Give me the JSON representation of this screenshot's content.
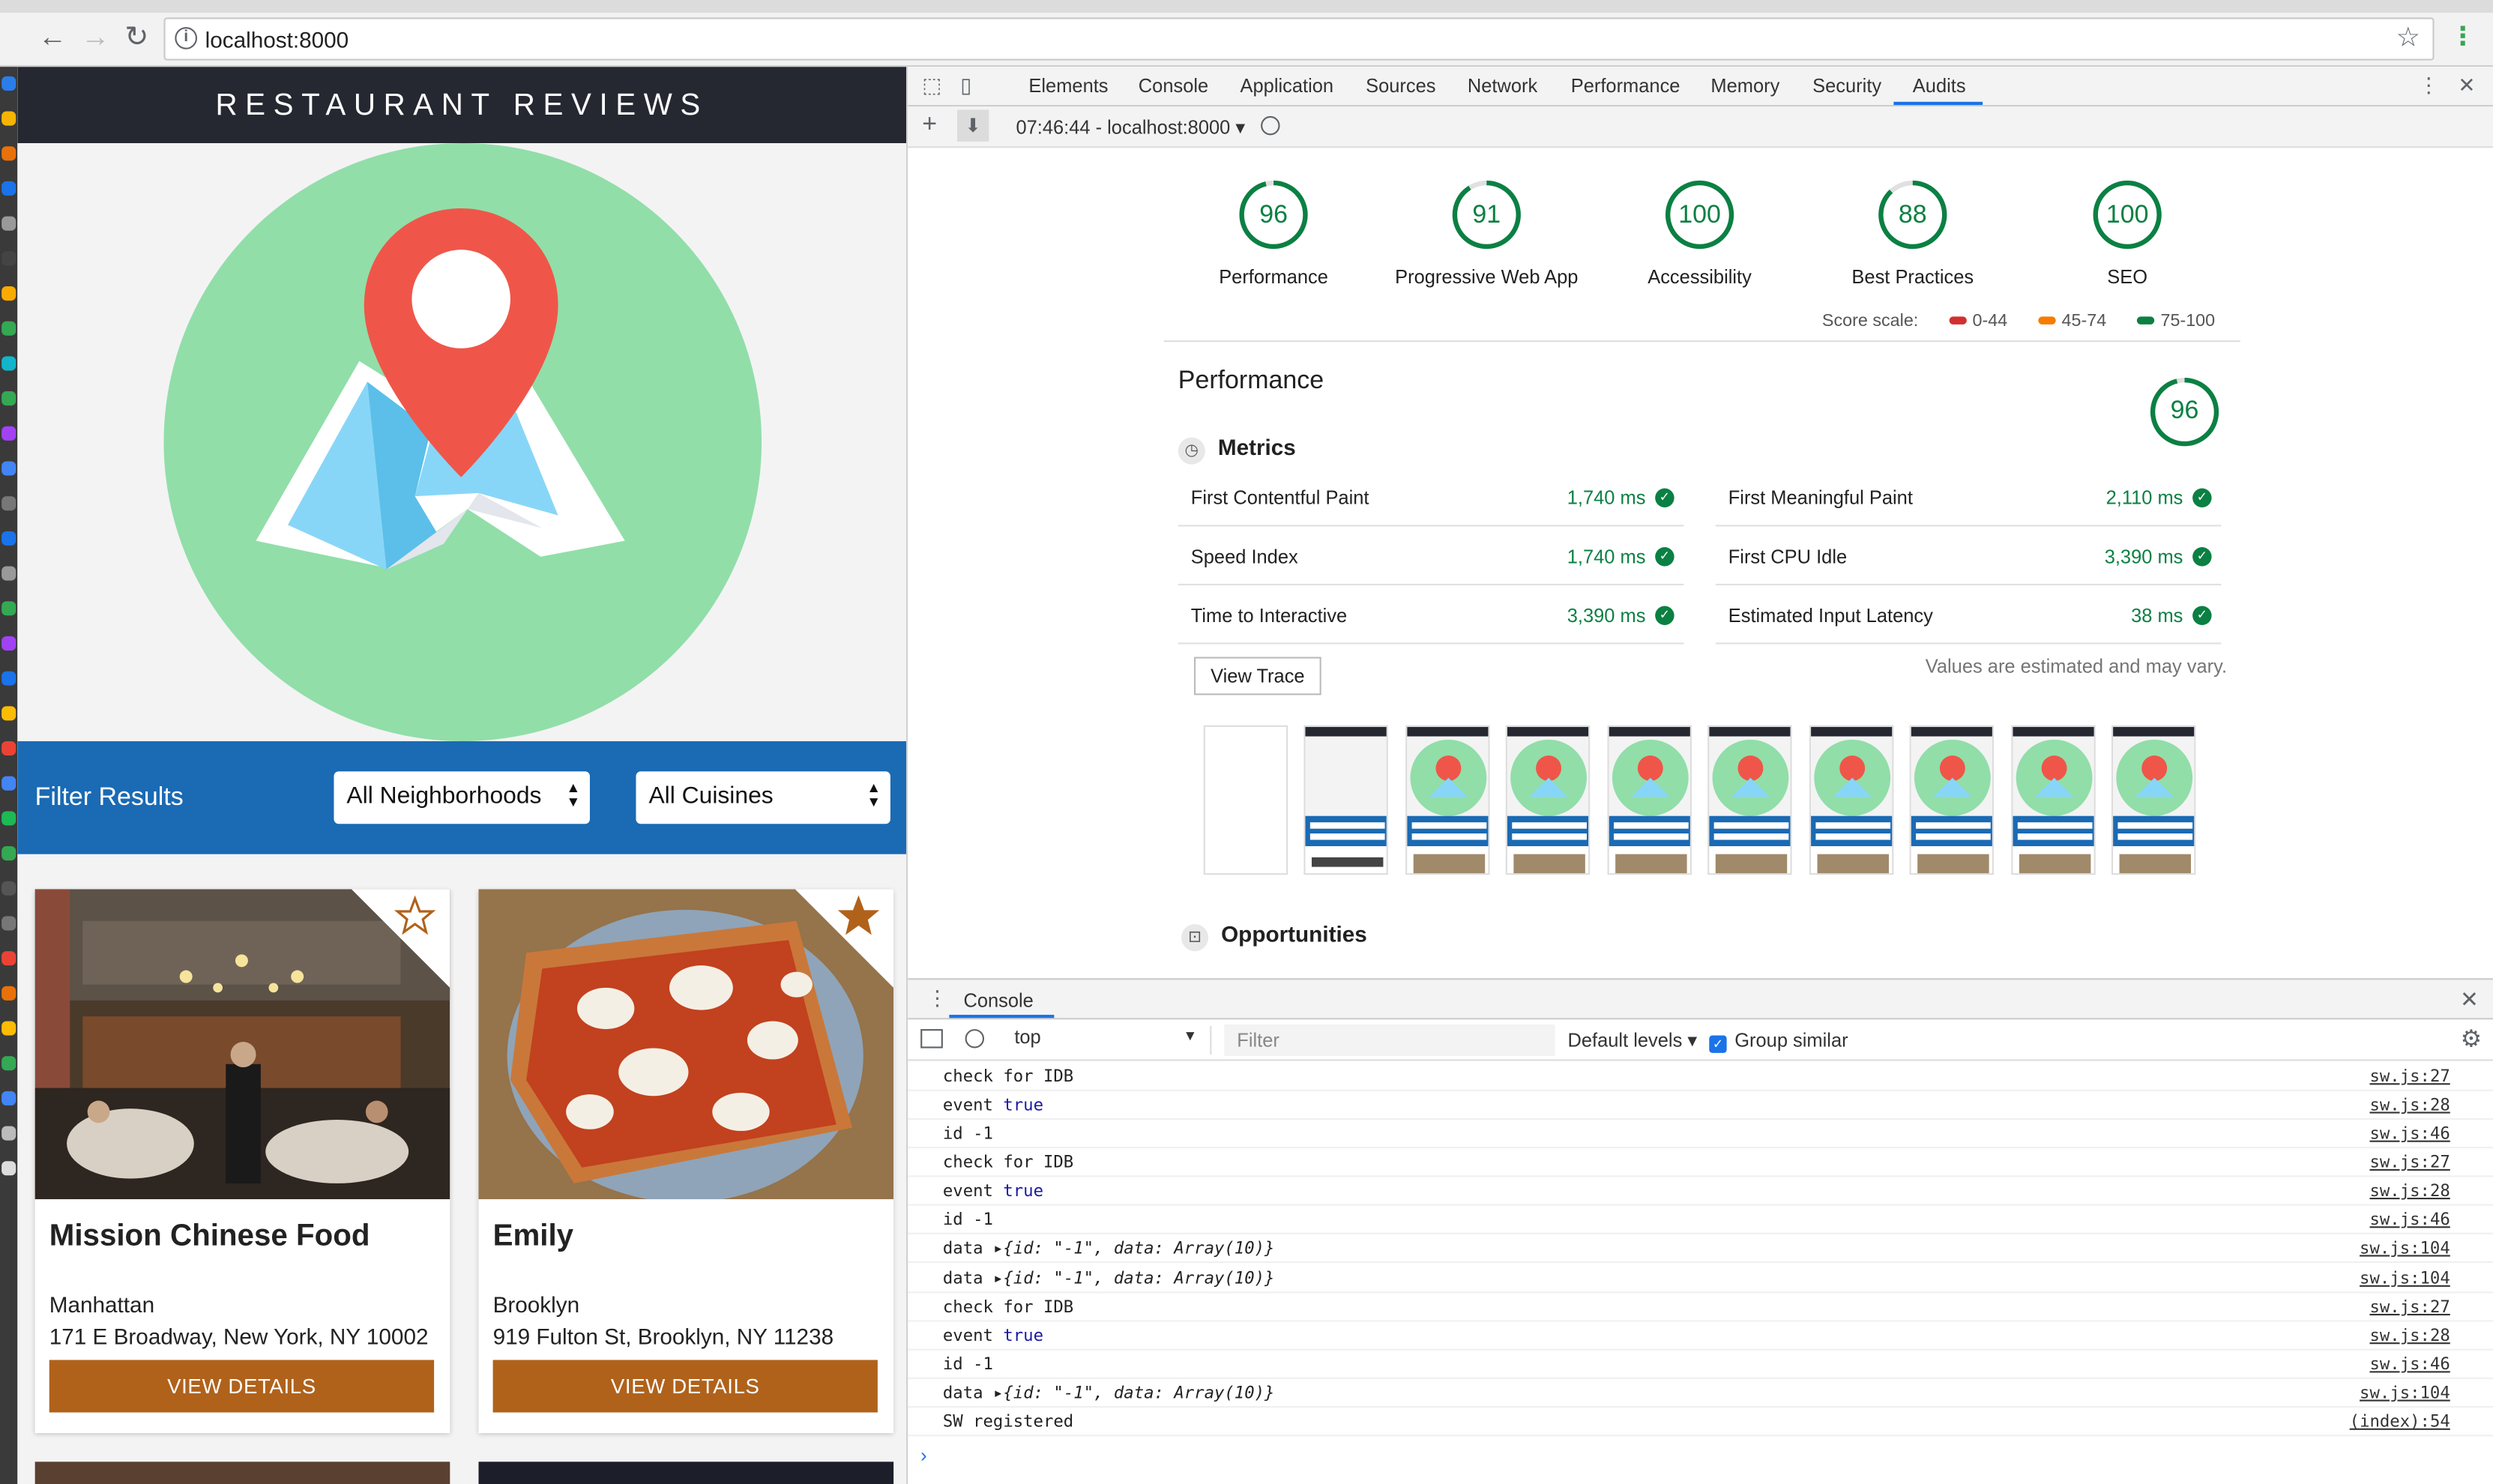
{
  "browser": {
    "url": "localhost:8000"
  },
  "site": {
    "title": "RESTAURANT REVIEWS",
    "filter": {
      "label": "Filter Results",
      "neighborhood_value": "All Neighborhoods",
      "cuisine_value": "All Cuisines"
    },
    "restaurants": [
      {
        "name": "Mission Chinese Food",
        "neighborhood": "Manhattan",
        "address": "171 E Broadway, New York, NY 10002",
        "button": "VIEW DETAILS",
        "favorite": false
      },
      {
        "name": "Emily",
        "neighborhood": "Brooklyn",
        "address": "919 Fulton St, Brooklyn, NY 11238",
        "button": "VIEW DETAILS",
        "favorite": true
      }
    ],
    "colors": {
      "header": "#252831",
      "filter_bar": "#1a6ab4",
      "button": "#b0621b",
      "map_circle": "#91dea9"
    }
  },
  "devtools": {
    "tabs": [
      "Elements",
      "Console",
      "Application",
      "Sources",
      "Network",
      "Performance",
      "Memory",
      "Security",
      "Audits"
    ],
    "active_tab": "Audits",
    "report_label": "07:46:44 - localhost:8000",
    "scores": [
      {
        "label": "Performance",
        "value": 96
      },
      {
        "label": "Progressive Web App",
        "value": 91
      },
      {
        "label": "Accessibility",
        "value": 100
      },
      {
        "label": "Best Practices",
        "value": 88
      },
      {
        "label": "SEO",
        "value": 100
      }
    ],
    "score_scale": {
      "label": "Score scale:",
      "ranges": [
        {
          "range": "0-44",
          "color": "#d32f2f"
        },
        {
          "range": "45-74",
          "color": "#f57c00"
        },
        {
          "range": "75-100",
          "color": "#0b8043"
        }
      ]
    },
    "performance": {
      "title": "Performance",
      "score": 96,
      "metrics_heading": "Metrics",
      "metrics": [
        {
          "name": "First Contentful Paint",
          "value": "1,740 ms"
        },
        {
          "name": "First Meaningful Paint",
          "value": "2,110 ms"
        },
        {
          "name": "Speed Index",
          "value": "1,740 ms"
        },
        {
          "name": "First CPU Idle",
          "value": "3,390 ms"
        },
        {
          "name": "Time to Interactive",
          "value": "3,390 ms"
        },
        {
          "name": "Estimated Input Latency",
          "value": "38 ms"
        }
      ],
      "view_trace": "View Trace",
      "estimated_note": "Values are estimated and may vary.",
      "opportunities_heading": "Opportunities"
    },
    "console": {
      "drawer_title": "Console",
      "context": "top",
      "filter_placeholder": "Filter",
      "levels": "Default levels",
      "group_similar": "Group similar",
      "logs": [
        {
          "kind": "plain",
          "text": "check for IDB",
          "source": "sw.js:27"
        },
        {
          "kind": "event",
          "text": "event",
          "value": "true",
          "source": "sw.js:28"
        },
        {
          "kind": "plain",
          "text": "id -1",
          "source": "sw.js:46"
        },
        {
          "kind": "plain",
          "text": "check for IDB",
          "source": "sw.js:27"
        },
        {
          "kind": "event",
          "text": "event",
          "value": "true",
          "source": "sw.js:28"
        },
        {
          "kind": "plain",
          "text": "id -1",
          "source": "sw.js:46"
        },
        {
          "kind": "data",
          "text": "data",
          "object": "{id: \"-1\", data: Array(10)}",
          "source": "sw.js:104"
        },
        {
          "kind": "data",
          "text": "data",
          "object": "{id: \"-1\", data: Array(10)}",
          "source": "sw.js:104"
        },
        {
          "kind": "plain",
          "text": "check for IDB",
          "source": "sw.js:27"
        },
        {
          "kind": "event",
          "text": "event",
          "value": "true",
          "source": "sw.js:28"
        },
        {
          "kind": "plain",
          "text": "id -1",
          "source": "sw.js:46"
        },
        {
          "kind": "data",
          "text": "data",
          "object": "{id: \"-1\", data: Array(10)}",
          "source": "sw.js:104"
        },
        {
          "kind": "plain",
          "text": "SW registered",
          "source": "(index):54"
        }
      ]
    }
  }
}
